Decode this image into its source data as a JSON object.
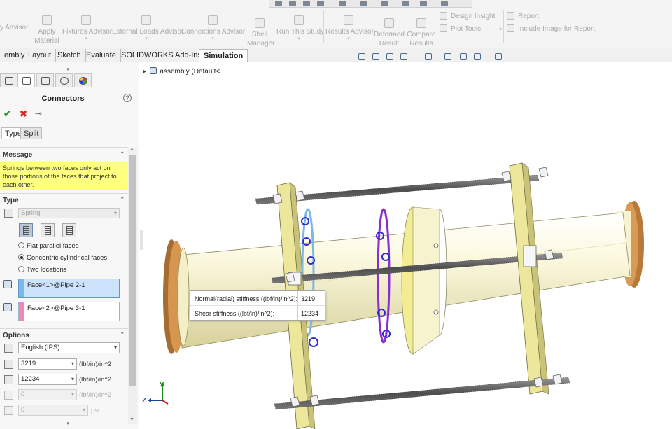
{
  "ribbon": {
    "items": [
      {
        "label": "y Advisor"
      },
      {
        "label": "Apply",
        "label2": "Material"
      },
      {
        "label": "Fixtures Advisor"
      },
      {
        "label": "External Loads Advisor"
      },
      {
        "label": "Connections Advisor"
      },
      {
        "label": "Shell",
        "label2": "Manager"
      },
      {
        "label": "Run This Study"
      },
      {
        "label": "Results Advisor"
      },
      {
        "label": "Deformed",
        "label2": "Result"
      },
      {
        "label": "Compare",
        "label2": "Results"
      }
    ],
    "design_insight": "Design Insight",
    "plot_tools": "Plot Tools",
    "report": "Report",
    "include_image": "Include Image for Report"
  },
  "tabs": [
    {
      "label": "embly"
    },
    {
      "label": "Layout"
    },
    {
      "label": "Sketch"
    },
    {
      "label": "Evaluate"
    },
    {
      "label": "SOLIDWORKS Add-Ins"
    },
    {
      "label": "Simulation"
    }
  ],
  "panel": {
    "title": "Connectors",
    "help": "?",
    "ok": "✔",
    "cancel": "✖",
    "pin": "⊸",
    "subtabs": {
      "type": "Type",
      "split": "Split"
    },
    "message": {
      "header": "Message",
      "text": "Springs between two faces only act on those portions of the faces that project to each other."
    },
    "type": {
      "header": "Type",
      "selected": "Spring",
      "radios": [
        {
          "label": "Flat parallel faces",
          "checked": false
        },
        {
          "label": "Concentric cylindrical faces",
          "checked": true
        },
        {
          "label": "Two locations",
          "checked": false
        }
      ],
      "face1": "Face<1>@Pipe 2-1",
      "face2": "Face<2>@Pipe 3-1",
      "face1_color": "#7cb8e6",
      "face2_color": "#f08ab4"
    },
    "options": {
      "header": "Options",
      "units": "English (IPS)",
      "normal_stiffness": "3219",
      "shear_stiffness": "12234",
      "stiffness_unit": "(lbf/in)/in^2",
      "field3": "0",
      "field3_unit": "(lbf/in)/in^2",
      "field4": "0",
      "field4_unit": "psi"
    }
  },
  "graphics": {
    "tree_label": "assembly  (Default<...",
    "tooltip": {
      "normal_label": "Normal(radial) stiffness ((lbf/in)/in^2):",
      "normal_value": "3219",
      "shear_label": "Shear stiffness ((lbf/in)/in^2):",
      "shear_value": "12234"
    },
    "triad": {
      "z": "Z",
      "y": "Y"
    }
  },
  "colors": {
    "pipe": "#f6f2c9",
    "flange": "#c98a42",
    "plate": "#ece79a",
    "spring_blue": "#2f2fc8",
    "spring_purple": "#8b2cd6"
  }
}
